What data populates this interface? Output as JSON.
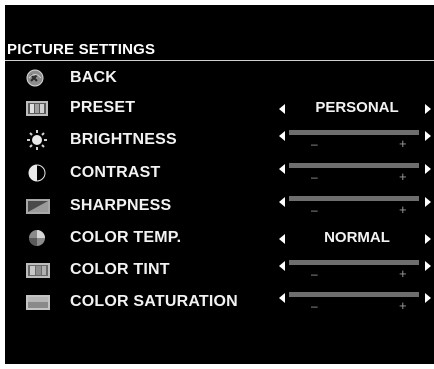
{
  "menu": {
    "title": "PICTURE SETTINGS",
    "items": [
      {
        "label": "BACK",
        "icon": "back-icon",
        "type": "action"
      },
      {
        "label": "PRESET",
        "icon": "preset-icon",
        "type": "select",
        "value": "PERSONAL"
      },
      {
        "label": "BRIGHTNESS",
        "icon": "brightness-icon",
        "type": "slider",
        "minus": "–",
        "plus": "+"
      },
      {
        "label": "CONTRAST",
        "icon": "contrast-icon",
        "type": "slider",
        "minus": "–",
        "plus": "+"
      },
      {
        "label": "SHARPNESS",
        "icon": "sharpness-icon",
        "type": "slider",
        "minus": "–",
        "plus": "+"
      },
      {
        "label": "COLOR TEMP.",
        "icon": "color-temp-icon",
        "type": "select",
        "value": "NORMAL"
      },
      {
        "label": "COLOR TINT",
        "icon": "color-tint-icon",
        "type": "slider",
        "minus": "–",
        "plus": "+"
      },
      {
        "label": "COLOR SATURATION",
        "icon": "color-saturation-icon",
        "type": "slider",
        "minus": "–",
        "plus": "+"
      }
    ]
  },
  "colors": {
    "background": "#000000",
    "text": "#ffffff",
    "slider_track": "#6e6e6e"
  }
}
